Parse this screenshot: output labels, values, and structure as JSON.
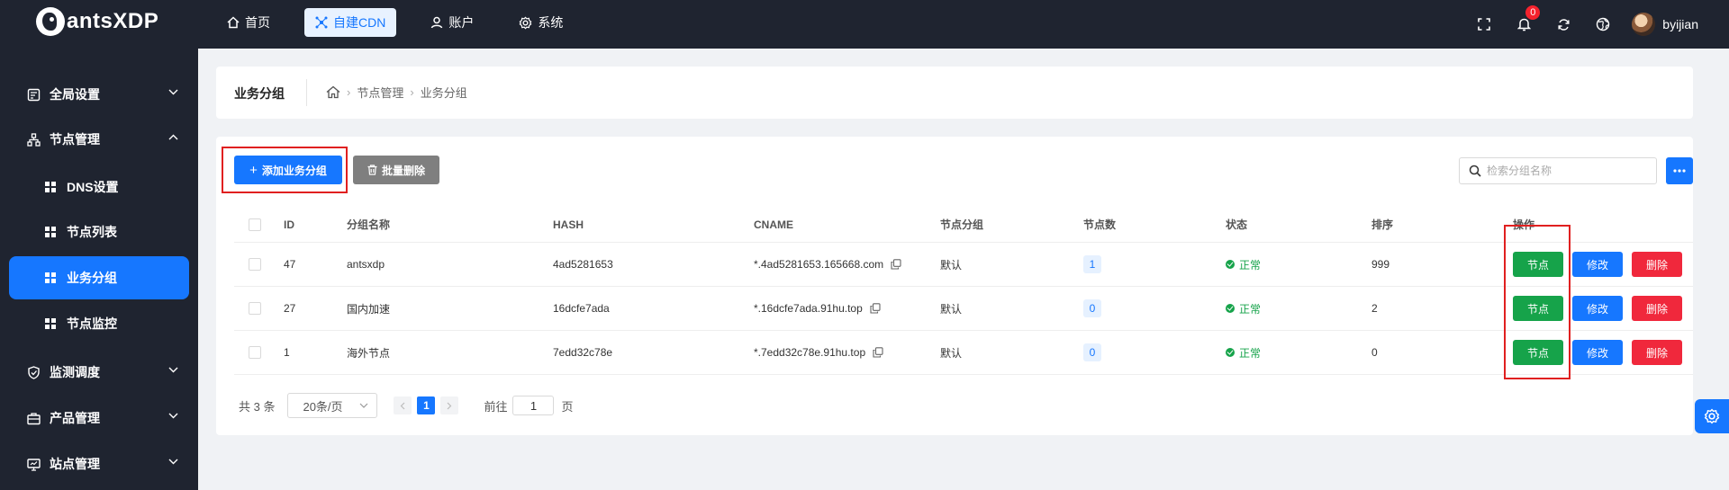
{
  "app": {
    "logo_text": "antsXDP"
  },
  "topnav": {
    "items": [
      {
        "label": "首页",
        "icon": "home-icon"
      },
      {
        "label": "自建CDN",
        "icon": "network-icon",
        "active": true
      },
      {
        "label": "账户",
        "icon": "user-icon"
      },
      {
        "label": "系统",
        "icon": "gear-icon"
      }
    ]
  },
  "header": {
    "notification_count": "0",
    "username": "byijian"
  },
  "sidebar": {
    "items": [
      {
        "label": "全局设置",
        "icon": "settings-panel-icon",
        "expanded": false
      },
      {
        "label": "节点管理",
        "icon": "tree-icon",
        "expanded": true
      },
      {
        "label": "监测调度",
        "icon": "shield-icon",
        "expanded": false
      },
      {
        "label": "产品管理",
        "icon": "briefcase-icon",
        "expanded": false
      },
      {
        "label": "站点管理",
        "icon": "monitor-icon",
        "expanded": false
      }
    ],
    "sub_items": [
      {
        "label": "DNS设置"
      },
      {
        "label": "节点列表"
      },
      {
        "label": "业务分组",
        "active": true
      },
      {
        "label": "节点监控"
      }
    ]
  },
  "breadcrumb": {
    "title": "业务分组",
    "path": [
      "节点管理",
      "业务分组"
    ]
  },
  "toolbar": {
    "add_label": "添加业务分组",
    "batch_delete_label": "批量删除",
    "search_placeholder": "检索分组名称"
  },
  "table": {
    "columns": {
      "id": "ID",
      "name": "分组名称",
      "hash": "HASH",
      "cname": "CNAME",
      "group": "节点分组",
      "count": "节点数",
      "status": "状态",
      "sort": "排序",
      "ops": "操作"
    },
    "action_labels": {
      "node": "节点",
      "edit": "修改",
      "remove": "删除"
    },
    "rows": [
      {
        "id": "47",
        "name": "antsxdp",
        "hash": "4ad5281653",
        "cname": "*.4ad5281653.165668.com",
        "group": "默认",
        "count": "1",
        "status": "正常",
        "sort": "999"
      },
      {
        "id": "27",
        "name": "国内加速",
        "hash": "16dcfe7ada",
        "cname": "*.16dcfe7ada.91hu.top",
        "group": "默认",
        "count": "0",
        "status": "正常",
        "sort": "2"
      },
      {
        "id": "1",
        "name": "海外节点",
        "hash": "7edd32c78e",
        "cname": "*.7edd32c78e.91hu.top",
        "group": "默认",
        "count": "0",
        "status": "正常",
        "sort": "0"
      }
    ]
  },
  "pagination": {
    "total_label": "共 3 条",
    "page_size_label": "20条/页",
    "current_page": "1",
    "goto_label": "前往",
    "goto_value": "1",
    "page_suffix": "页"
  }
}
